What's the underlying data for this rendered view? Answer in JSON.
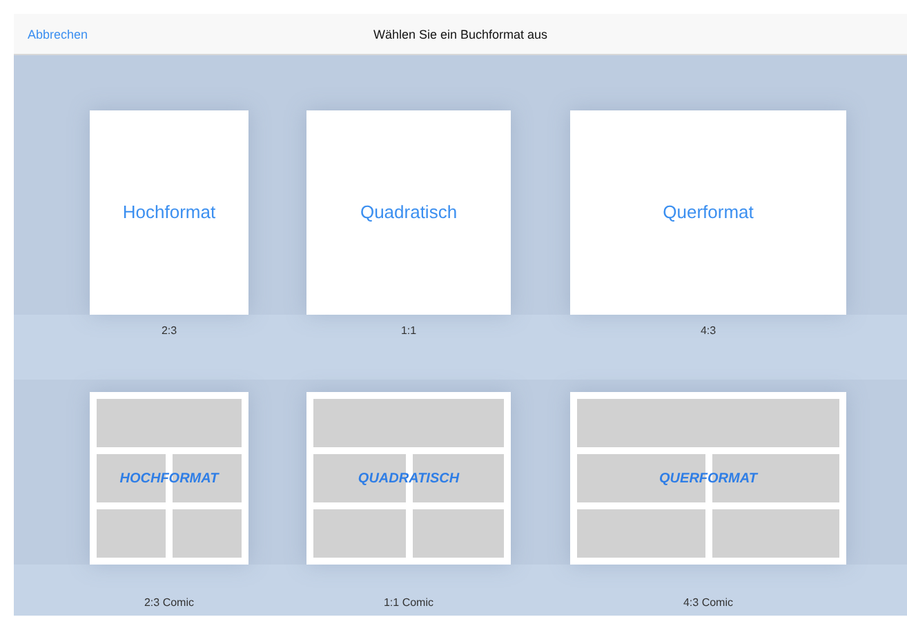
{
  "header": {
    "cancel": "Abbrechen",
    "title": "Wählen Sie ein Buchformat aus"
  },
  "sections": [
    {
      "kind": "plain",
      "items": [
        {
          "kind": "portrait",
          "label": "Hochformat",
          "caption": "2:3"
        },
        {
          "kind": "square",
          "label": "Quadratisch",
          "caption": "1:1"
        },
        {
          "kind": "landscape",
          "label": "Querformat",
          "caption": "4:3"
        }
      ]
    },
    {
      "kind": "comic",
      "items": [
        {
          "kind": "portrait",
          "label": "HOCHFORMAT",
          "caption": "2:3 Comic"
        },
        {
          "kind": "square",
          "label": "QUADRATISCH",
          "caption": "1:1 Comic"
        },
        {
          "kind": "landscape",
          "label": "QUERFORMAT",
          "caption": "4:3 Comic"
        }
      ]
    }
  ]
}
